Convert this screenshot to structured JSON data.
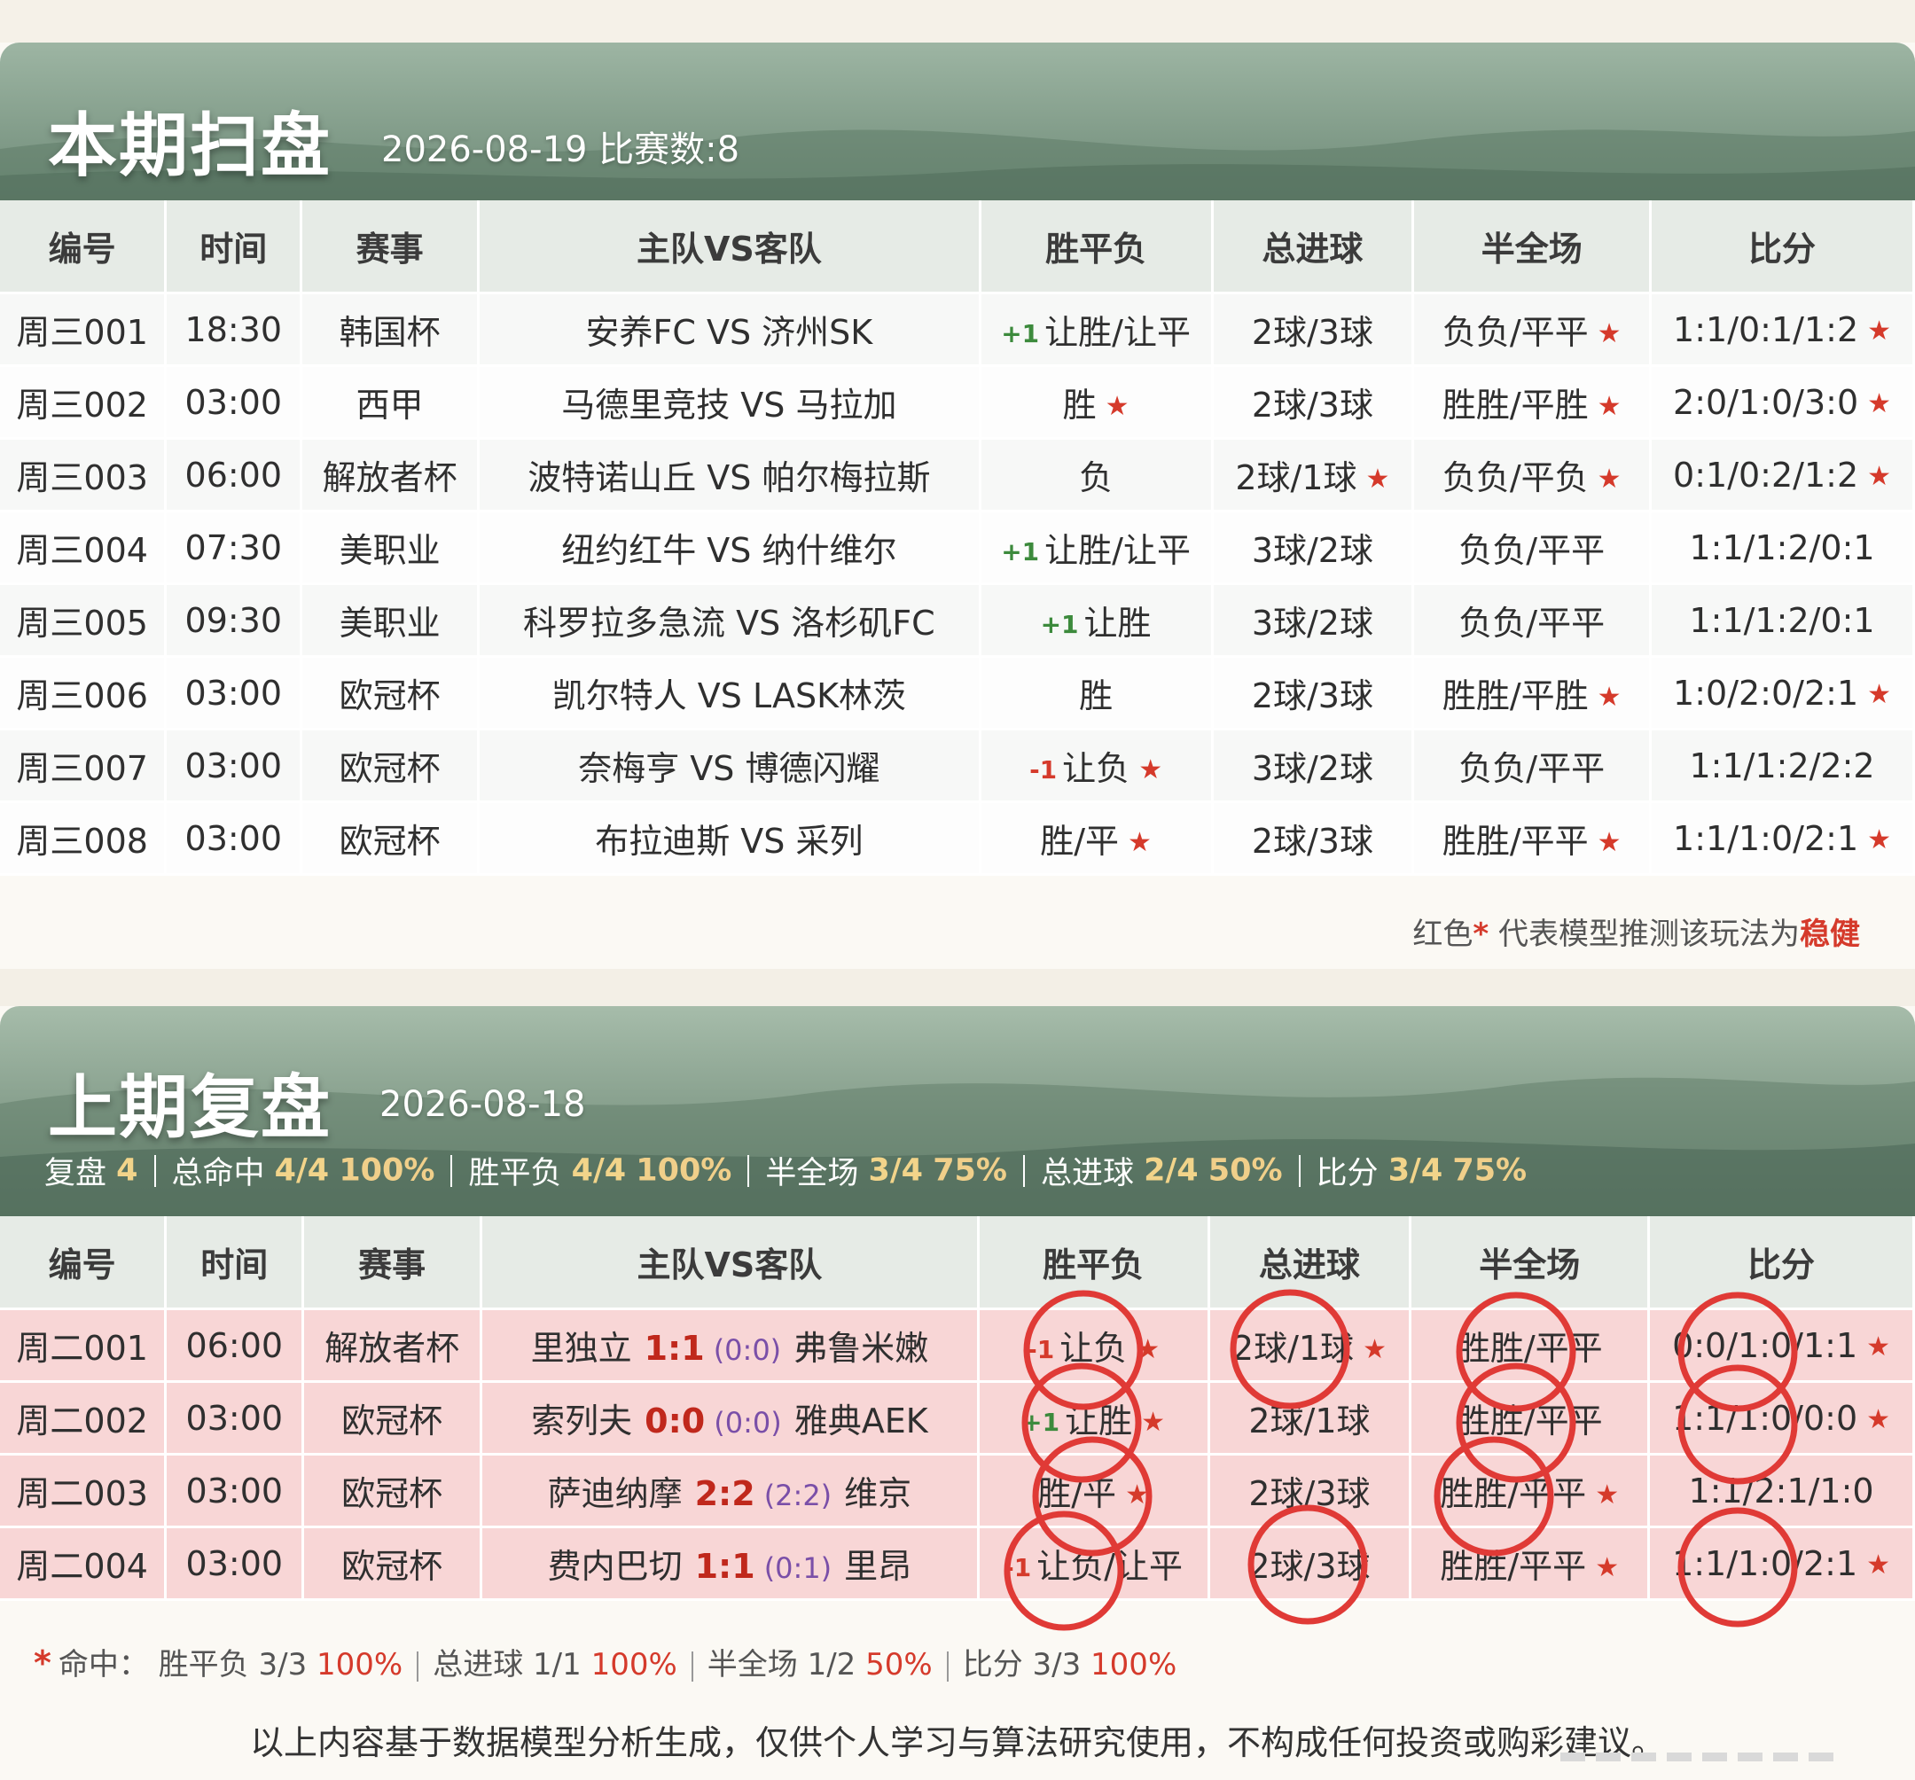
{
  "current": {
    "title": "本期扫盘",
    "subtitle": "2026-08-19 比赛数:8",
    "headers": [
      "编号",
      "时间",
      "赛事",
      "主队VS客队",
      "胜平负",
      "总进球",
      "半全场",
      "比分"
    ],
    "rows": [
      {
        "id": "周三001",
        "time": "18:30",
        "league": "韩国杯",
        "match": "安养FC VS 济州SK",
        "handicap": "+1",
        "wdl": "让胜/让平",
        "wdl_star": false,
        "goals": "2球/3球",
        "goals_star": false,
        "htft": "负负/平平",
        "htft_star": true,
        "score": "1:1/0:1/1:2",
        "score_star": true
      },
      {
        "id": "周三002",
        "time": "03:00",
        "league": "西甲",
        "match": "马德里竞技 VS 马拉加",
        "handicap": "",
        "wdl": "胜",
        "wdl_star": true,
        "goals": "2球/3球",
        "goals_star": false,
        "htft": "胜胜/平胜",
        "htft_star": true,
        "score": "2:0/1:0/3:0",
        "score_star": true
      },
      {
        "id": "周三003",
        "time": "06:00",
        "league": "解放者杯",
        "match": "波特诺山丘 VS 帕尔梅拉斯",
        "handicap": "",
        "wdl": "负",
        "wdl_star": false,
        "goals": "2球/1球",
        "goals_star": true,
        "htft": "负负/平负",
        "htft_star": true,
        "score": "0:1/0:2/1:2",
        "score_star": true
      },
      {
        "id": "周三004",
        "time": "07:30",
        "league": "美职业",
        "match": "纽约红牛 VS 纳什维尔",
        "handicap": "+1",
        "wdl": "让胜/让平",
        "wdl_star": false,
        "goals": "3球/2球",
        "goals_star": false,
        "htft": "负负/平平",
        "htft_star": false,
        "score": "1:1/1:2/0:1",
        "score_star": false
      },
      {
        "id": "周三005",
        "time": "09:30",
        "league": "美职业",
        "match": "科罗拉多急流 VS 洛杉矶FC",
        "handicap": "+1",
        "wdl": "让胜",
        "wdl_star": false,
        "goals": "3球/2球",
        "goals_star": false,
        "htft": "负负/平平",
        "htft_star": false,
        "score": "1:1/1:2/0:1",
        "score_star": false
      },
      {
        "id": "周三006",
        "time": "03:00",
        "league": "欧冠杯",
        "match": "凯尔特人 VS LASK林茨",
        "handicap": "",
        "wdl": "胜",
        "wdl_star": false,
        "goals": "2球/3球",
        "goals_star": false,
        "htft": "胜胜/平胜",
        "htft_star": true,
        "score": "1:0/2:0/2:1",
        "score_star": true
      },
      {
        "id": "周三007",
        "time": "03:00",
        "league": "欧冠杯",
        "match": "奈梅亨 VS 博德闪耀",
        "handicap": "-1",
        "wdl": "让负",
        "wdl_star": true,
        "goals": "3球/2球",
        "goals_star": false,
        "htft": "负负/平平",
        "htft_star": false,
        "score": "1:1/1:2/2:2",
        "score_star": false
      },
      {
        "id": "周三008",
        "time": "03:00",
        "league": "欧冠杯",
        "match": "布拉迪斯 VS 采列",
        "handicap": "",
        "wdl": "胜/平",
        "wdl_star": true,
        "goals": "2球/3球",
        "goals_star": false,
        "htft": "胜胜/平平",
        "htft_star": true,
        "score": "1:1/1:0/2:1",
        "score_star": true
      }
    ],
    "legend": {
      "prefix": "红色",
      "star": "*",
      "middle": " 代表模型推测该玩法为",
      "emph": "稳健"
    }
  },
  "previous": {
    "title": "上期复盘",
    "subtitle": "2026-08-18",
    "stats": [
      {
        "label": "复盘",
        "value": "4",
        "pct": ""
      },
      {
        "label": "总命中",
        "value": "4/4",
        "pct": "100%"
      },
      {
        "label": "胜平负",
        "value": "4/4",
        "pct": "100%"
      },
      {
        "label": "半全场",
        "value": "3/4",
        "pct": "75%"
      },
      {
        "label": "总进球",
        "value": "2/4",
        "pct": "50%"
      },
      {
        "label": "比分",
        "value": "3/4",
        "pct": "75%"
      }
    ],
    "headers": [
      "编号",
      "时间",
      "赛事",
      "主队VS客队",
      "胜平负",
      "总进球",
      "半全场",
      "比分"
    ],
    "rows": [
      {
        "id": "周二001",
        "time": "06:00",
        "league": "解放者杯",
        "home": "里独立",
        "score_ft": "1:1",
        "score_ht": "(0:0)",
        "away": "弗鲁米嫩",
        "handicap": "-1",
        "wdl": "让负",
        "wdl_star": true,
        "goals": "2球/1球",
        "goals_star": true,
        "htft": "胜胜/平平",
        "htft_star": false,
        "score": "0:0/1:0/1:1",
        "score_star": true
      },
      {
        "id": "周二002",
        "time": "03:00",
        "league": "欧冠杯",
        "home": "索列夫",
        "score_ft": "0:0",
        "score_ht": "(0:0)",
        "away": "雅典AEK",
        "handicap": "+1",
        "wdl": "让胜",
        "wdl_star": true,
        "goals": "2球/1球",
        "goals_star": false,
        "htft": "胜胜/平平",
        "htft_star": false,
        "score": "1:1/1:0/0:0",
        "score_star": true
      },
      {
        "id": "周二003",
        "time": "03:00",
        "league": "欧冠杯",
        "home": "萨迪纳摩",
        "score_ft": "2:2",
        "score_ht": "(2:2)",
        "away": "维京",
        "handicap": "",
        "wdl": "胜/平",
        "wdl_star": true,
        "goals": "2球/3球",
        "goals_star": false,
        "htft": "胜胜/平平",
        "htft_star": true,
        "score": "1:1/2:1/1:0",
        "score_star": false
      },
      {
        "id": "周二004",
        "time": "03:00",
        "league": "欧冠杯",
        "home": "费内巴切",
        "score_ft": "1:1",
        "score_ht": "(0:1)",
        "away": "里昂",
        "handicap": "-1",
        "wdl": "让负/让平",
        "wdl_star": false,
        "goals": "2球/3球",
        "goals_star": false,
        "htft": "胜胜/平平",
        "htft_star": true,
        "score": "1:1/1:0/2:1",
        "score_star": true
      }
    ],
    "hits": {
      "star": "*",
      "label": "命中：",
      "items": [
        {
          "name": "胜平负 3/3",
          "pct": "100%"
        },
        {
          "name": "总进球 1/1",
          "pct": "100%"
        },
        {
          "name": "半全场 1/2",
          "pct": "50%"
        },
        {
          "name": "比分 3/3",
          "pct": "100%"
        }
      ]
    }
  },
  "disclaimer": "以上内容基于数据模型分析生成，仅供个人学习与算法研究使用，不构成任何投资或购彩建议。",
  "colors": {
    "header_green": "#6f8b78",
    "accent_red": "#d53a2b",
    "gold": "#f2d48a",
    "row_pink": "#f8d6d6"
  }
}
